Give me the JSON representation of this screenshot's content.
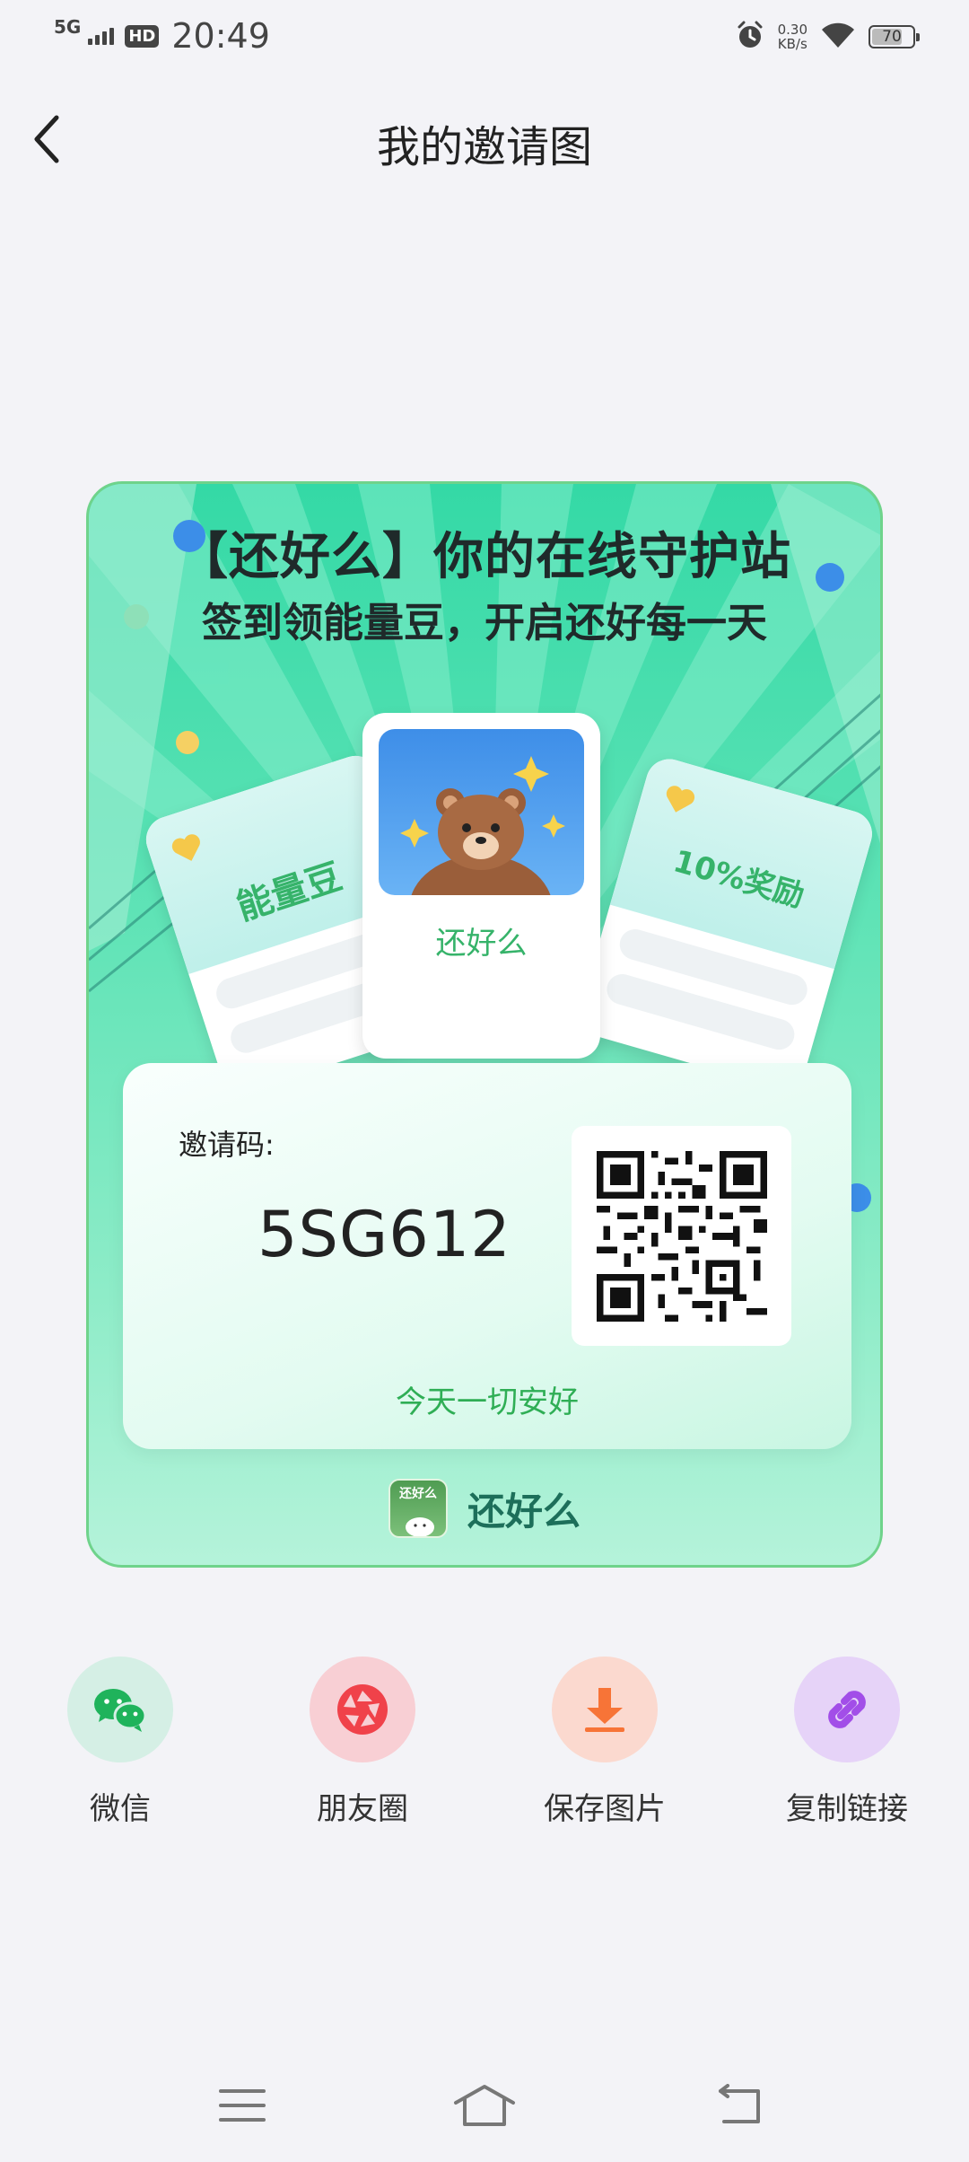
{
  "status_bar": {
    "network": "5G",
    "hd": "HD",
    "time": "20:49",
    "speed_value": "0.30",
    "speed_unit": "KB/s",
    "battery": "70"
  },
  "header": {
    "title": "我的邀请图"
  },
  "invite_card": {
    "headline": "【还好么】你的在线守护站",
    "subline": "签到领能量豆，开启还好每一天",
    "left_card_label": "能量豆",
    "center_card_label": "还好么",
    "right_card_label": "10%奖励",
    "code_label": "邀请码:",
    "code_value": "5SG612",
    "tagline": "今天一切安好",
    "brand_logo_text": "还好么",
    "brand_name": "还好么"
  },
  "share": {
    "items": [
      {
        "label": "微信",
        "icon": "wechat-icon",
        "color": "#1fb35b",
        "bg": "#d5efe5"
      },
      {
        "label": "朋友圈",
        "icon": "moments-icon",
        "color": "#f0424a",
        "bg": "#f8cfd4"
      },
      {
        "label": "保存图片",
        "icon": "download-icon",
        "color": "#f77437",
        "bg": "#fbd9cf"
      },
      {
        "label": "复制链接",
        "icon": "link-icon",
        "color": "#a24ee8",
        "bg": "#e6d3f8"
      }
    ]
  },
  "colors": {
    "background": "#f3f3f7",
    "card_green": "#34d9a6",
    "accent_green": "#2fae55"
  }
}
